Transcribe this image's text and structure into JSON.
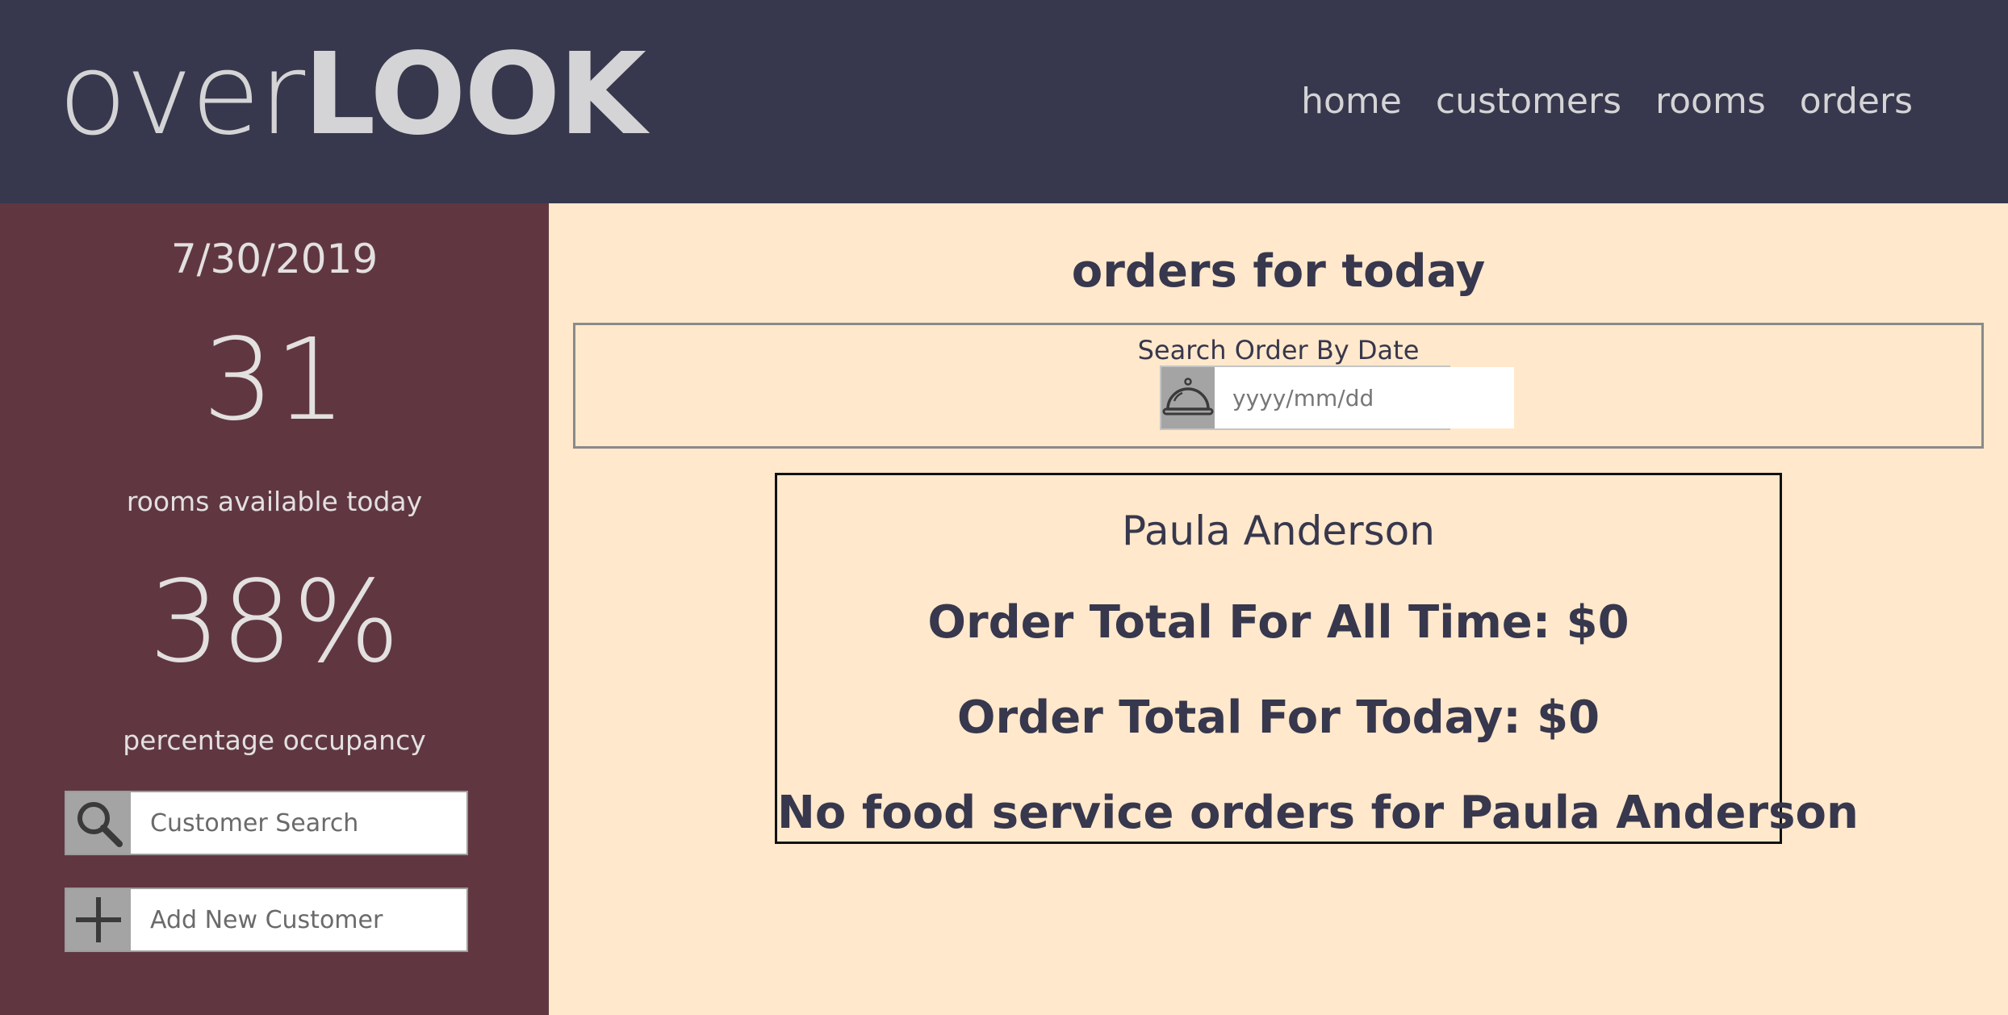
{
  "header": {
    "logo_thin": "over",
    "logo_bold": "LOOK",
    "nav": [
      "home",
      "customers",
      "rooms",
      "orders"
    ]
  },
  "sidebar": {
    "date": "7/30/2019",
    "rooms_available": "31",
    "rooms_available_label": "rooms available today",
    "occupancy": "38%",
    "occupancy_label": "percentage occupancy",
    "customer_search_placeholder": "Customer Search",
    "add_customer_placeholder": "Add New Customer"
  },
  "main": {
    "title": "orders for today",
    "search_label": "Search Order By Date",
    "date_placeholder": "yyyy/mm/dd",
    "customer": {
      "name": "Paula Anderson",
      "total_all_time": "Order Total For All Time: $0",
      "total_today": "Order Total For Today: $0",
      "no_orders": "No food service orders for Paula Anderson"
    }
  },
  "colors": {
    "header_bg": "#37374d",
    "sidebar_bg": "#603741",
    "main_bg": "#ffe8cb",
    "accent_text": "#37374d"
  },
  "icons": {
    "customer_search": "search-icon",
    "add_customer": "plus-icon",
    "date_search": "service-bell-icon"
  }
}
